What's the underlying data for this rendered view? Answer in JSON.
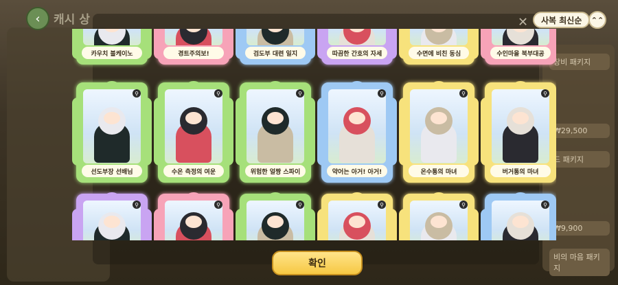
{
  "background": {
    "title": "캐시 상",
    "panels": [
      "장비 패키지",
      "₩29,500",
      "드 패키지",
      "₩9,900",
      "비의 마음 패키지"
    ]
  },
  "header": {
    "sort_label": "사복 최신순",
    "sort_toggle_icon": "chevron-double-up-icon"
  },
  "rows": [
    {
      "cards": [
        {
          "label": "카우치 블케이노",
          "theme": "green"
        },
        {
          "label": "경트주의보!",
          "theme": "pink"
        },
        {
          "label": "검도부 대련 일지",
          "theme": "blue"
        },
        {
          "label": "따끔한 간호의 자세",
          "theme": "purple"
        },
        {
          "label": "수면에 비친 동심",
          "theme": "yellow"
        },
        {
          "label": "수인마을 북부대공",
          "theme": "pink"
        }
      ]
    },
    {
      "cards": [
        {
          "label": "선도부장 선배님",
          "theme": "green"
        },
        {
          "label": "수온 측정의 여운",
          "theme": "green"
        },
        {
          "label": "위험한 얼짱 스파이",
          "theme": "green"
        },
        {
          "label": "약어는 아거! 아거!",
          "theme": "blue"
        },
        {
          "label": "온수통의 마녀",
          "theme": "yellow"
        },
        {
          "label": "버거통의 마녀",
          "theme": "yellow"
        }
      ]
    },
    {
      "cards": [
        {
          "label": "",
          "theme": "purple"
        },
        {
          "label": "",
          "theme": "pink"
        },
        {
          "label": "",
          "theme": "green"
        },
        {
          "label": "",
          "theme": "yellow"
        },
        {
          "label": "",
          "theme": "yellow"
        },
        {
          "label": "",
          "theme": "blue"
        }
      ]
    }
  ],
  "confirm_label": "확인",
  "colors": {
    "green": "#a6e07a",
    "pink": "#f7a3b8",
    "blue": "#9ec9f4",
    "purple": "#c9a4f2",
    "yellow": "#f7e27c"
  }
}
